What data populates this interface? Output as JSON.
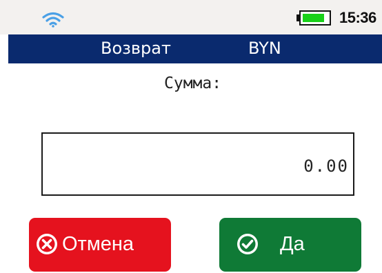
{
  "status_bar": {
    "wifi_icon": "wifi-icon",
    "battery_level": 0.85,
    "battery_color": "#19d119",
    "time": "15:36"
  },
  "header": {
    "title": "Возврат",
    "currency": "BYN",
    "background_color": "#0a2a6e"
  },
  "amount": {
    "label": "Сумма:",
    "value": "0.00"
  },
  "buttons": {
    "cancel": {
      "label": "Отмена",
      "icon": "x-circle-icon",
      "color": "#e5121e"
    },
    "ok": {
      "label": "Да",
      "icon": "check-circle-icon",
      "color": "#0f7a36"
    }
  }
}
